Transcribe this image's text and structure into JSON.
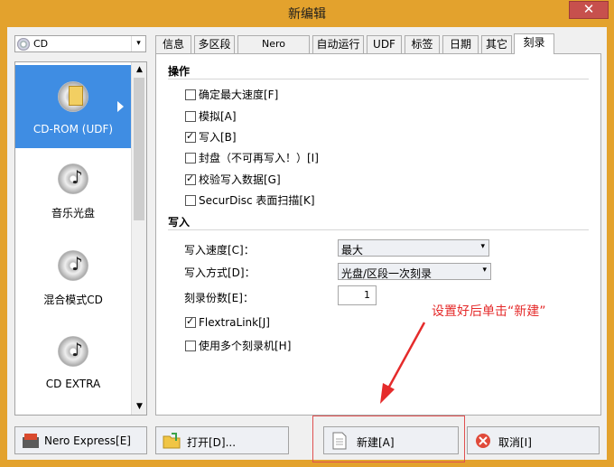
{
  "window": {
    "title": "新编辑",
    "close_glyph": "✕"
  },
  "disc_type": {
    "value": "CD",
    "arrow": "▾"
  },
  "compilations": [
    {
      "label": "CD-ROM (UDF)",
      "icon": "cd-doc-icon",
      "selected": true
    },
    {
      "label": "音乐光盘",
      "icon": "music-cd-icon",
      "selected": false
    },
    {
      "label": "混合模式CD",
      "icon": "mixed-mode-cd-icon",
      "selected": false
    },
    {
      "label": "CD EXTRA",
      "icon": "cd-extra-icon",
      "selected": false
    }
  ],
  "scroll": {
    "up": "▲",
    "down": "▼"
  },
  "tabs": [
    "信息",
    "多区段",
    "Nero DiscSpan",
    "自动运行",
    "UDF",
    "标签",
    "日期",
    "其它",
    "刻录"
  ],
  "active_tab": "刻录",
  "operations": {
    "heading": "操作",
    "items": [
      {
        "label": "确定最大速度[F]",
        "checked": false
      },
      {
        "label": "模拟[A]",
        "checked": false
      },
      {
        "label": "写入[B]",
        "checked": true
      },
      {
        "label": "封盘（不可再写入！）[I]",
        "checked": false
      },
      {
        "label": "校验写入数据[G]",
        "checked": true
      },
      {
        "label": "SecurDisc 表面扫描[K]",
        "checked": false
      }
    ]
  },
  "write": {
    "heading": "写入",
    "speed_label": "写入速度[C]：",
    "speed_value": "最大",
    "method_label": "写入方式[D]：",
    "method_value": "光盘/区段一次刻录",
    "copies_label": "刻录份数[E]：",
    "copies_value": "1",
    "flextralink": {
      "label": "FlextraLink[J]",
      "checked": true
    },
    "multi_recorder": {
      "label": "使用多个刻录机[H]",
      "checked": false
    }
  },
  "annotation_text": "设置好后单击“新建”",
  "buttons": {
    "nero_express": "Nero Express[E]",
    "open": "打开[D]...",
    "new": "新建[A]",
    "cancel": "取消[I]"
  }
}
